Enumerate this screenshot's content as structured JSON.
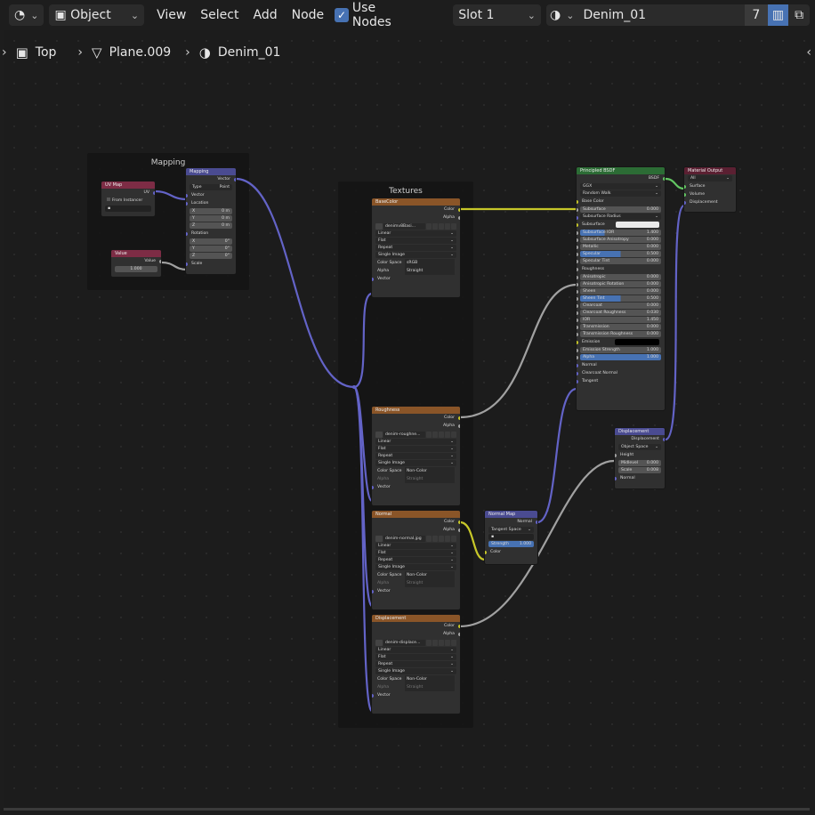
{
  "header": {
    "mode": "Object",
    "menu": [
      "View",
      "Select",
      "Add",
      "Node"
    ],
    "use_nodes_label": "Use Nodes",
    "slot": "Slot 1",
    "material": "Denim_01",
    "user_count": "7"
  },
  "breadcrumb": {
    "view": "Top",
    "object": "Plane.009",
    "material": "Denim_01"
  },
  "frames": {
    "mapping": "Mapping",
    "textures": "Textures"
  },
  "nodes": {
    "uvmap": {
      "title": "UV Map",
      "out": "UV",
      "from_instancer": "From Instancer"
    },
    "value": {
      "title": "Value",
      "out": "Value",
      "val": "1.000"
    },
    "mapping": {
      "title": "Mapping",
      "out": "Vector",
      "type_label": "Type",
      "type_value": "Point",
      "vector": "Vector",
      "location": "Location",
      "rotation": "Rotation",
      "scale": "Scale",
      "x": "X",
      "y": "Y",
      "z": "Z",
      "loc_val": "0 m",
      "rot_val": "0°"
    },
    "tex_common": {
      "color": "Color",
      "alpha": "Alpha",
      "linear": "Linear",
      "flat": "Flat",
      "repeat": "Repeat",
      "single": "Single Image",
      "colorspace": "Color Space",
      "alpha_label": "Alpha",
      "straight": "Straight",
      "vector": "Vector"
    },
    "basecolor": {
      "title": "BaseColor",
      "file": "denimv8Basi...",
      "colorspace": "sRGB"
    },
    "roughness": {
      "title": "Roughness",
      "file": "denim-roughne...",
      "colorspace": "Non-Color"
    },
    "normal": {
      "title": "Normal",
      "file": "denim-normal.jpg",
      "colorspace": "Non-Color"
    },
    "displacement_tex": {
      "title": "Displacement",
      "file": "denim-displace...",
      "colorspace": "Non-Color"
    },
    "normalmap": {
      "title": "Normal Map",
      "out": "Normal",
      "space": "Tangent Space",
      "strength": "Strength",
      "strength_val": "1.000",
      "color": "Color"
    },
    "displacement": {
      "title": "Displacement",
      "out": "Displacement",
      "space": "Object Space",
      "height": "Height",
      "midlevel": "Midlevel",
      "mid_val": "0.000",
      "scale": "Scale",
      "scale_val": "0.008",
      "normal": "Normal"
    },
    "bsdf": {
      "title": "Principled BSDF",
      "out": "BSDF",
      "dist": "GGX",
      "sss": "Random Walk",
      "rows": [
        [
          "Base Color",
          ""
        ],
        [
          "Subsurface",
          "0.000"
        ],
        [
          "Subsurface Radius",
          ""
        ],
        [
          "Subsurface Color",
          ""
        ],
        [
          "Subsurface IOR",
          "1.400"
        ],
        [
          "Subsurface Anisotropy",
          "0.000"
        ],
        [
          "Metallic",
          "0.000"
        ],
        [
          "Specular",
          "0.500"
        ],
        [
          "Specular Tint",
          "0.000"
        ],
        [
          "Roughness",
          ""
        ],
        [
          "Anisotropic",
          "0.000"
        ],
        [
          "Anisotropic Rotation",
          "0.000"
        ],
        [
          "Sheen",
          "0.000"
        ],
        [
          "Sheen Tint",
          "0.500"
        ],
        [
          "Clearcoat",
          "0.000"
        ],
        [
          "Clearcoat Roughness",
          "0.030"
        ],
        [
          "IOR",
          "1.450"
        ],
        [
          "Transmission",
          "0.000"
        ],
        [
          "Transmission Roughness",
          "0.000"
        ],
        [
          "Emission",
          ""
        ],
        [
          "Emission Strength",
          "1.000"
        ],
        [
          "Alpha",
          "1.000"
        ],
        [
          "Normal",
          ""
        ],
        [
          "Clearcoat Normal",
          ""
        ],
        [
          "Tangent",
          ""
        ]
      ]
    },
    "output": {
      "title": "Material Output",
      "target": "All",
      "surface": "Surface",
      "volume": "Volume",
      "displacement": "Displacement"
    }
  }
}
